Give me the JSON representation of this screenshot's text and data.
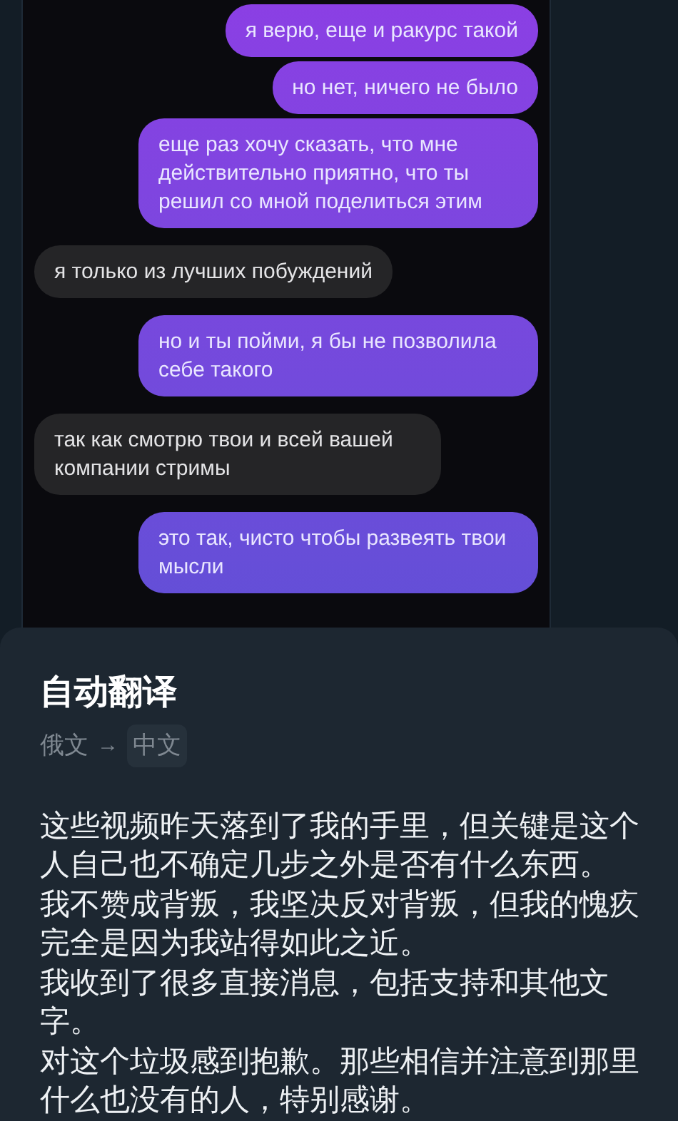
{
  "chat": {
    "messages": [
      {
        "kind": "outgoing",
        "text": "я верю, еще и ракурс такой"
      },
      {
        "kind": "outgoing",
        "text": "но нет, ничего не было"
      },
      {
        "kind": "outgoing",
        "text": "еще раз хочу сказать, что мне действительно приятно, что ты решил со мной поделиться этим"
      },
      {
        "kind": "incoming",
        "text": "я только из лучших побуждений"
      },
      {
        "kind": "outgoing",
        "text": "но и ты пойми, я бы не позволила себе такого"
      },
      {
        "kind": "incoming",
        "text": "так как смотрю твои и всей вашей компании стримы"
      },
      {
        "kind": "outgoing",
        "text": "это так, чисто чтобы развеять твои мысли"
      }
    ]
  },
  "translation": {
    "title": "自动翻译",
    "source_language": "俄文",
    "arrow": "→",
    "target_language": "中文",
    "paragraphs": [
      "这些视频昨天落到了我的手里，但关键是这个人自己也不确定几步之外是否有什么东西。",
      "我不赞成背叛，我坚决反对背叛，但我的愧疚完全是因为我站得如此之近。",
      "我收到了很多直接消息，包括支持和其他文字。",
      "对这个垃圾感到抱歉。那些相信并注意到那里什么也没有的人，特别感谢。"
    ]
  }
}
